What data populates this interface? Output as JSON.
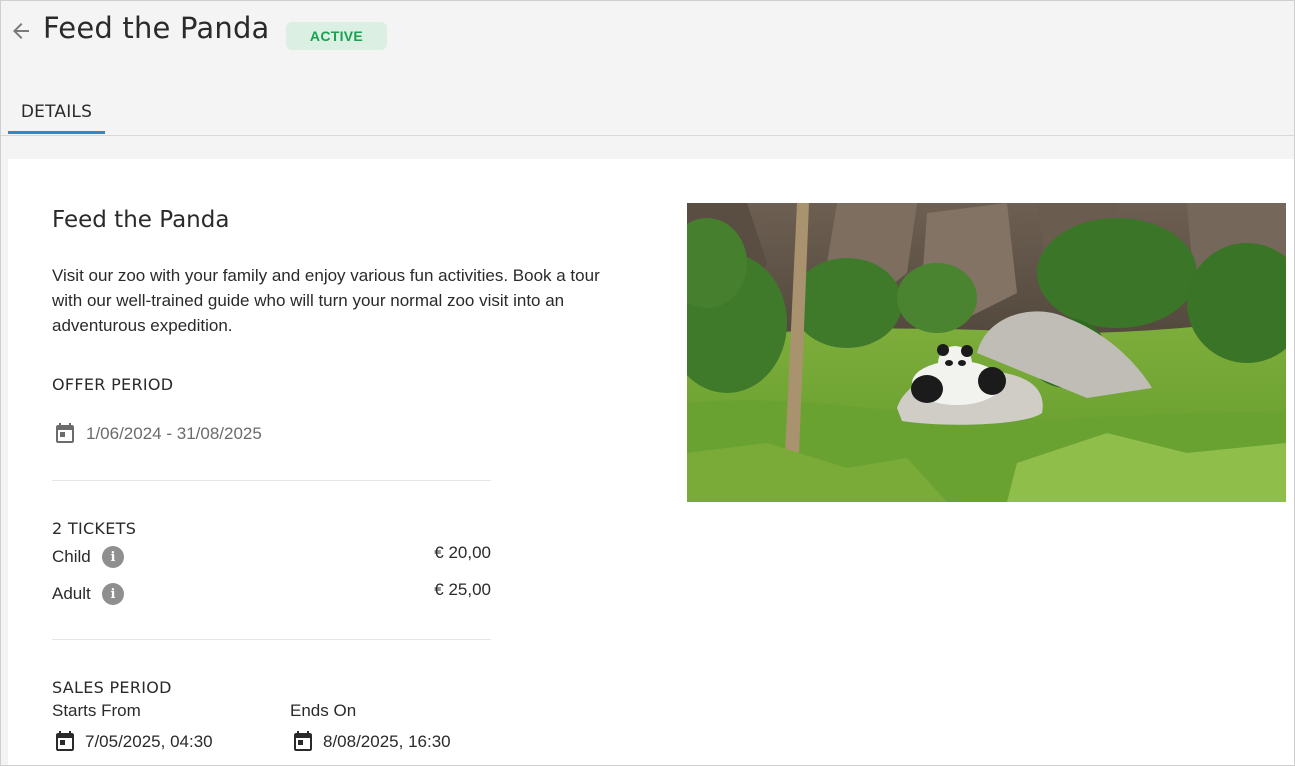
{
  "header": {
    "title": "Feed the Panda",
    "status": "ACTIVE",
    "back_icon": "arrow-left-icon"
  },
  "tabs": [
    {
      "label": "DETAILS",
      "active": true
    }
  ],
  "details": {
    "title": "Feed the Panda",
    "description": "Visit our zoo with your family and enjoy various fun activities. Book a tour with our well-trained guide who will turn your normal zoo visit into an adventurous expedition.",
    "offer_period": {
      "heading": "OFFER PERIOD",
      "range": "1/06/2024 - 31/08/2025",
      "icon": "calendar-icon"
    },
    "tickets": {
      "heading": "2 TICKETS",
      "items": [
        {
          "label": "Child",
          "price": "€ 20,00",
          "icon": "info-icon"
        },
        {
          "label": "Adult",
          "price": "€ 25,00",
          "icon": "info-icon"
        }
      ]
    },
    "sales_period": {
      "heading": "SALES PERIOD",
      "starts_label": "Starts From",
      "starts_value": "7/05/2025, 04:30",
      "ends_label": "Ends On",
      "ends_value": "8/08/2025, 16:30",
      "icon": "calendar-icon"
    }
  },
  "image": {
    "subject": "panda-resting-on-rock-photo"
  },
  "colors": {
    "accent": "#2a8ad0",
    "status_text": "#1aa152",
    "status_bg": "#dcefe3",
    "page_bg": "#f4f4f4"
  }
}
